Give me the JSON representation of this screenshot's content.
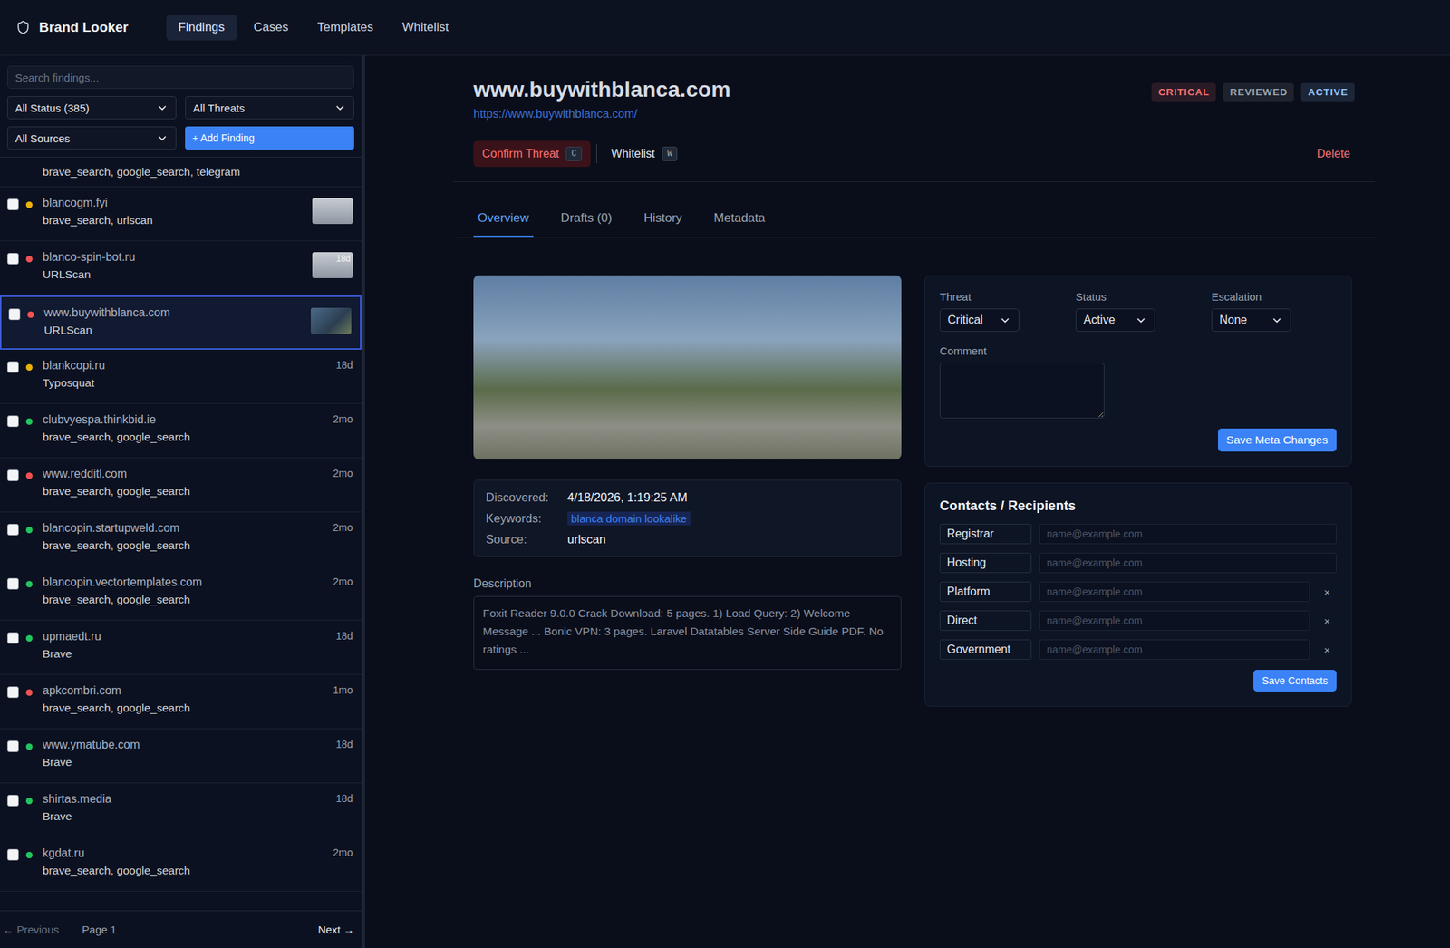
{
  "app": {
    "name": "Brand Looker"
  },
  "nav": [
    {
      "label": "Findings",
      "selected": true
    },
    {
      "label": "Cases",
      "selected": false
    },
    {
      "label": "Templates",
      "selected": false
    },
    {
      "label": "Whitelist",
      "selected": false
    }
  ],
  "sidebar": {
    "search": {
      "placeholder": "Search findings..."
    },
    "filters": [
      {
        "label": "All Status (385)"
      },
      {
        "label": "All Threats"
      },
      {
        "label": "All Sources"
      }
    ],
    "add_button": "+ Add Finding",
    "items": [
      {
        "partial": true,
        "sources": "brave_search, google_search, telegram"
      },
      {
        "partial": false,
        "name": "blancogm.fyi",
        "sources": "brave_search, urlscan",
        "color": "#eab308",
        "age": "",
        "thumbnail": true,
        "selected": false,
        "checked": false
      },
      {
        "partial": false,
        "name": "blanco-spin-bot.ru",
        "sources": "URLScan",
        "color": "#f05252",
        "age": "18d",
        "thumbnail": true,
        "selected": false,
        "checked": false
      },
      {
        "partial": false,
        "name": "www.buywithblanca.com",
        "sources": "URLScan",
        "color": "#f05252",
        "age": "",
        "thumbnail": true,
        "selected": true,
        "checked": false
      },
      {
        "partial": false,
        "name": "blankcopi.ru",
        "sources": "Typosquat",
        "color": "#eab308",
        "age": "18d",
        "thumbnail": false,
        "selected": false,
        "checked": false
      },
      {
        "partial": false,
        "name": "clubvyespa.thinkbid.ie",
        "sources": "brave_search, google_search",
        "color": "#22c55e",
        "age": "2mo",
        "thumbnail": false,
        "selected": false,
        "checked": false
      },
      {
        "partial": false,
        "name": "www.redditl.com",
        "sources": "brave_search, google_search",
        "color": "#f05252",
        "age": "2mo",
        "thumbnail": false,
        "selected": false,
        "checked": false
      },
      {
        "partial": false,
        "name": "blancopin.startupweld.com",
        "sources": "brave_search, google_search",
        "color": "#22c55e",
        "age": "2mo",
        "thumbnail": false,
        "selected": false,
        "checked": false
      },
      {
        "partial": false,
        "name": "blancopin.vectortemplates.com",
        "sources": "brave_search, google_search",
        "color": "#22c55e",
        "age": "2mo",
        "thumbnail": false,
        "selected": false,
        "checked": false
      },
      {
        "partial": false,
        "name": "upmaedt.ru",
        "sources": "Brave",
        "color": "#22c55e",
        "age": "18d",
        "thumbnail": false,
        "selected": false,
        "checked": false
      },
      {
        "partial": false,
        "name": "apkcombri.com",
        "sources": "brave_search, google_search",
        "color": "#f05252",
        "age": "1mo",
        "thumbnail": false,
        "selected": false,
        "checked": false
      },
      {
        "partial": false,
        "name": "www.ymatube.com",
        "sources": "Brave",
        "color": "#22c55e",
        "age": "18d",
        "thumbnail": false,
        "selected": false,
        "checked": false
      },
      {
        "partial": false,
        "name": "shirtas.media",
        "sources": "Brave",
        "color": "#22c55e",
        "age": "18d",
        "thumbnail": false,
        "selected": false,
        "checked": false
      },
      {
        "partial": false,
        "name": "kgdat.ru",
        "sources": "brave_search, google_search",
        "color": "#22c55e",
        "age": "2mo",
        "thumbnail": false,
        "selected": false,
        "checked": false
      }
    ],
    "pagination": {
      "previous": "← Previous",
      "previous_disabled": true,
      "page": "Page 1",
      "next": "Next →"
    }
  },
  "finding": {
    "title": "www.buywithblanca.com",
    "url": "https://www.buywithblanca.com/",
    "badges": [
      {
        "label": "CRITICAL",
        "color": "#f87171"
      },
      {
        "label": "REVIEWED",
        "color": "#9ca3af"
      },
      {
        "label": "ACTIVE",
        "color": "#93c5fd"
      }
    ],
    "actions": [
      {
        "label": "Confirm Threat",
        "key": "C",
        "kind": "danger"
      },
      {
        "label": "Whitelist",
        "key": "W",
        "kind": "plain"
      }
    ],
    "delete": "Delete",
    "tabs": [
      {
        "label": "Overview",
        "selected": true
      },
      {
        "label": "Drafts (0)",
        "selected": false
      },
      {
        "label": "History",
        "selected": false
      },
      {
        "label": "Metadata",
        "selected": false
      }
    ],
    "info": [
      {
        "label": "Discovered:",
        "value": "4/18/2026, 1:19:25 AM",
        "kind": "text"
      },
      {
        "label": "Keywords:",
        "value": "blanca domain lookalike",
        "kind": "tag"
      },
      {
        "label": "Source:",
        "value": "urlscan",
        "kind": "text"
      }
    ],
    "description": {
      "label": "Description",
      "value": "Foxit Reader 9.0.0 Crack Download: 5 pages. 1) Load Query: 2) Welcome Message ... Bonic VPN: 3 pages. Laravel Datatables Server Side Guide PDF. No ratings ..."
    },
    "meta": {
      "fields": [
        {
          "label": "Threat",
          "value": "Critical"
        },
        {
          "label": "Status",
          "value": "Active"
        },
        {
          "label": "Escalation",
          "value": "None"
        }
      ],
      "comment": {
        "label": "Comment",
        "value": ""
      },
      "save": "Save Meta Changes"
    },
    "contacts": {
      "title": "Contacts / Recipients",
      "remove": "×",
      "save": "Save Contacts",
      "rows": [
        {
          "label": "Registrar",
          "placeholder": "name@example.com",
          "removable": false
        },
        {
          "label": "Hosting",
          "placeholder": "name@example.com",
          "removable": false
        },
        {
          "label": "Platform",
          "placeholder": "name@example.com",
          "removable": true
        },
        {
          "label": "Direct",
          "placeholder": "name@example.com",
          "removable": true
        },
        {
          "label": "Government",
          "placeholder": "name@example.com",
          "removable": true
        }
      ]
    }
  }
}
